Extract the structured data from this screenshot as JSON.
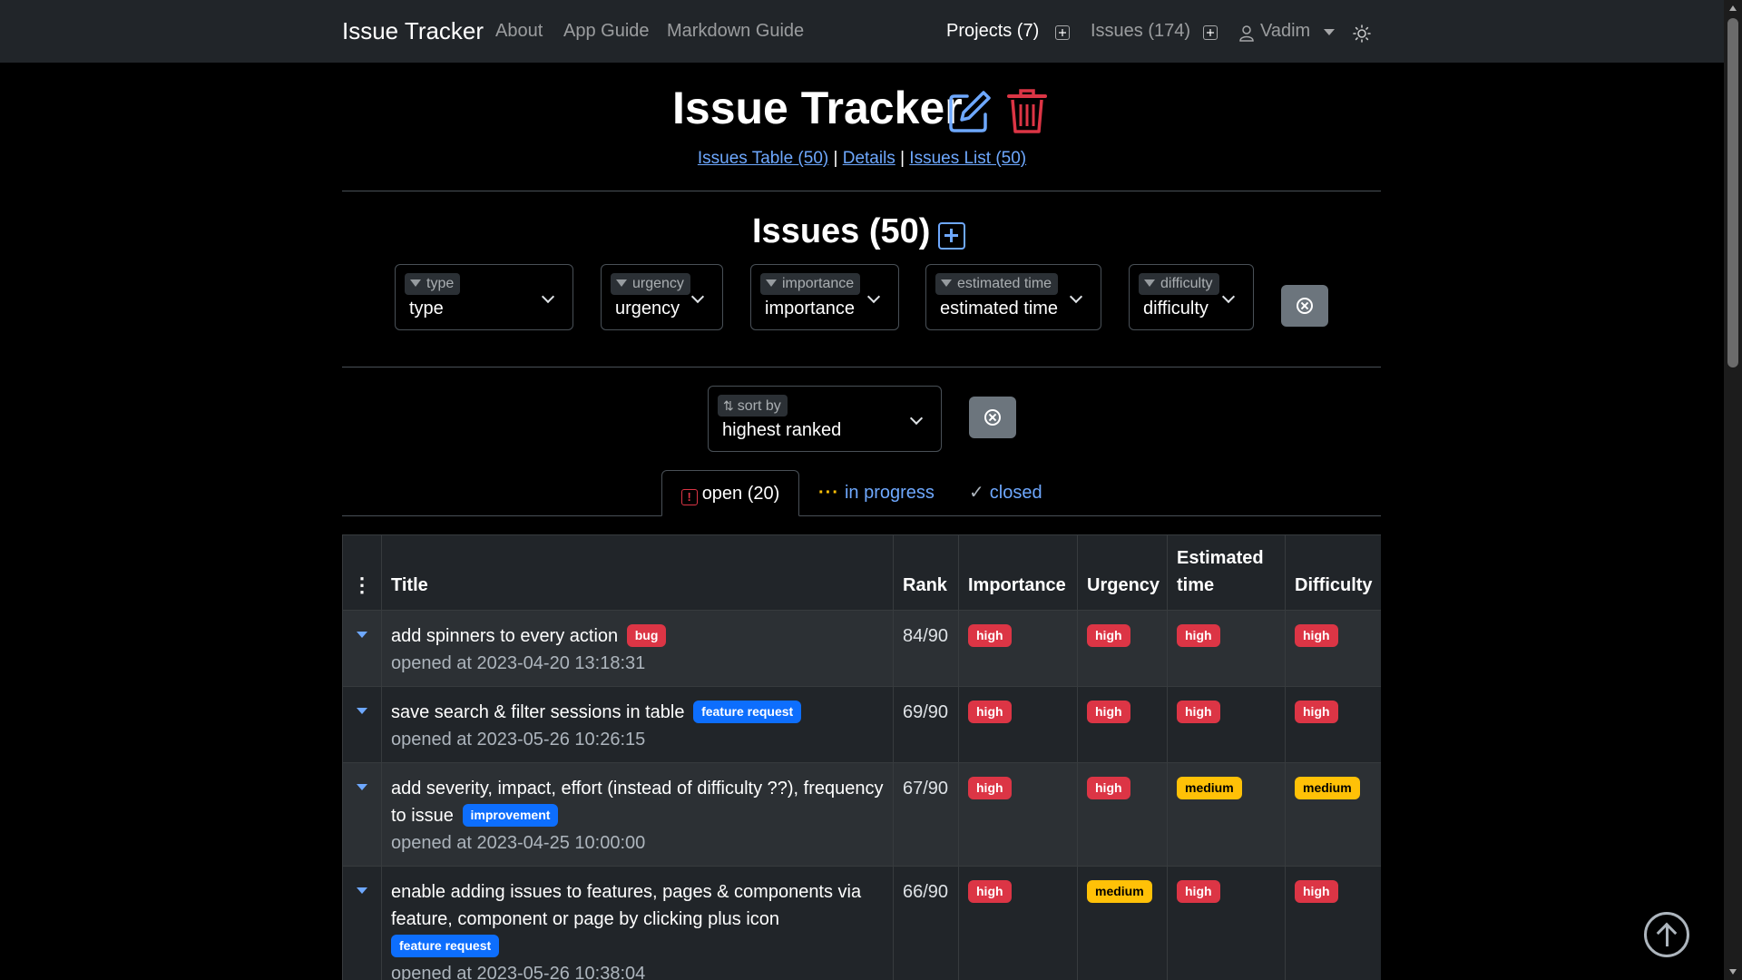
{
  "navbar": {
    "brand": "Issue Tracker",
    "links": [
      "About",
      "App Guide",
      "Markdown Guide"
    ],
    "projects": "Projects (7)",
    "issues": "Issues (174)",
    "user": "Vadim"
  },
  "header": {
    "title": "Issue Tracker",
    "links": [
      "Issues Table (50)",
      "Details",
      "Issues List (50)"
    ],
    "separator": "|"
  },
  "issues": {
    "title": "Issues (50)"
  },
  "filters": [
    {
      "label": "type",
      "value": "type"
    },
    {
      "label": "urgency",
      "value": "urgency"
    },
    {
      "label": "importance",
      "value": "importance"
    },
    {
      "label": "estimated time",
      "value": "estimated time"
    },
    {
      "label": "difficulty",
      "value": "difficulty"
    }
  ],
  "sort": {
    "label": "sort by",
    "value": "highest ranked"
  },
  "tabs": {
    "open": "open (20)",
    "in_progress": "in progress",
    "closed": "closed"
  },
  "table": {
    "headers": [
      "Title",
      "Rank",
      "Importance",
      "Urgency",
      "Estimated time",
      "Difficulty"
    ],
    "rows": [
      {
        "title": "add spinners to every action",
        "tag": "bug",
        "opened": "opened at 2023-04-20 13:18:31",
        "rank": "84/90",
        "importance": "high",
        "urgency": "high",
        "estimated_time": "high",
        "difficulty": "high"
      },
      {
        "title": "save search & filter sessions in table",
        "tag": "feature request",
        "opened": "opened at 2023-05-26 10:26:15",
        "rank": "69/90",
        "importance": "high",
        "urgency": "high",
        "estimated_time": "high",
        "difficulty": "high"
      },
      {
        "title": "add severity, impact, effort (instead of difficulty ??), frequency to issue",
        "tag": "improvement",
        "opened": "opened at 2023-04-25 10:00:00",
        "rank": "67/90",
        "importance": "high",
        "urgency": "high",
        "estimated_time": "medium",
        "difficulty": "medium"
      },
      {
        "title": "enable adding issues to features, pages & components via feature, component or page by clicking plus icon",
        "tag": "feature request",
        "opened": "opened at 2023-05-26 10:38:04",
        "rank": "66/90",
        "importance": "high",
        "urgency": "medium",
        "estimated_time": "high",
        "difficulty": "high"
      }
    ]
  }
}
